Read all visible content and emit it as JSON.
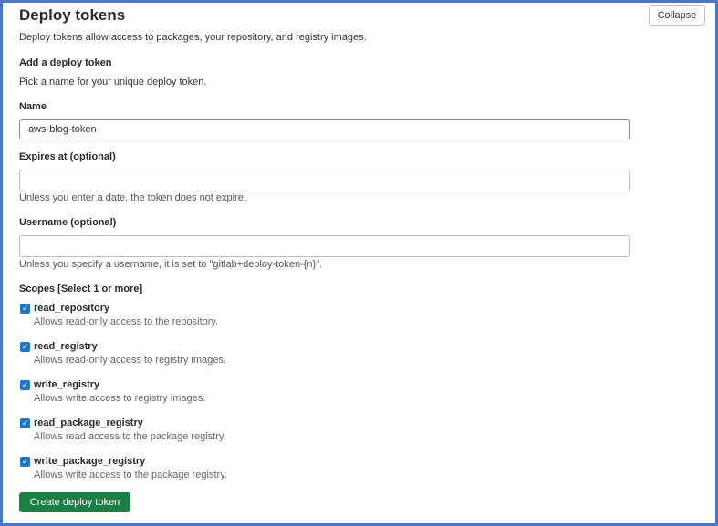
{
  "header": {
    "title": "Deploy tokens",
    "collapse_label": "Collapse",
    "description": "Deploy tokens allow access to packages, your repository, and registry images."
  },
  "form": {
    "subtitle": "Add a deploy token",
    "subtitle_help": "Pick a name for your unique deploy token.",
    "name": {
      "label": "Name",
      "value": "aws-blog-token"
    },
    "expires": {
      "label": "Expires at (optional)",
      "value": "",
      "help": "Unless you enter a date, the token does not expire."
    },
    "username": {
      "label": "Username (optional)",
      "value": "",
      "help": "Unless you specify a username, it is set to \"gitlab+deploy-token-{n}\"."
    },
    "scopes_label": "Scopes [Select 1 or more]",
    "scopes": [
      {
        "name": "read_repository",
        "desc": "Allows read-only access to the repository.",
        "checked": true
      },
      {
        "name": "read_registry",
        "desc": "Allows read-only access to registry images.",
        "checked": true
      },
      {
        "name": "write_registry",
        "desc": "Allows write access to registry images.",
        "checked": true
      },
      {
        "name": "read_package_registry",
        "desc": "Allows read access to the package registry.",
        "checked": true
      },
      {
        "name": "write_package_registry",
        "desc": "Allows write access to the package registry.",
        "checked": true
      }
    ],
    "submit_label": "Create deploy token"
  },
  "colors": {
    "primary": "#1f75cb",
    "success": "#1a7f43",
    "frame": "#4a76c7"
  }
}
